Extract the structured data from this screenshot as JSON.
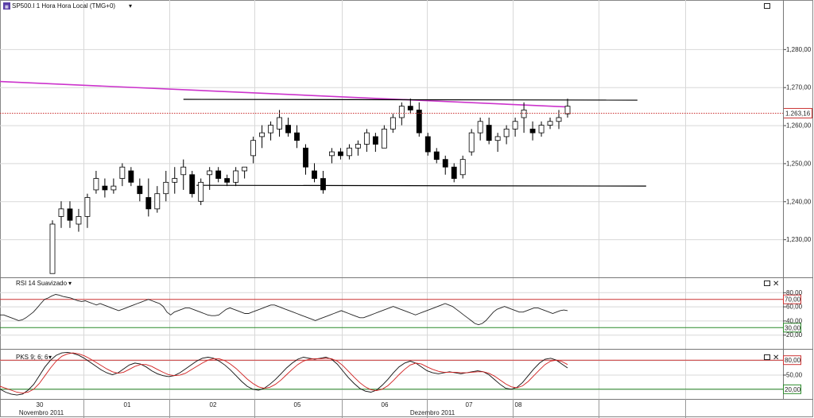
{
  "chart_data": [
    {
      "type": "candlestick",
      "title": "SP500.I 1 Hora Hora Local (TMG+0)",
      "ylim": [
        1220,
        1290
      ],
      "yticks": [
        "1,280,00",
        "1,270,00",
        "1,260,00",
        "1,250,00",
        "1,240,00",
        "1,230,00"
      ],
      "ytick_values": [
        1280,
        1270,
        1260,
        1250,
        1240,
        1230
      ],
      "price_label": "1.263,16",
      "price_line": 1263.16,
      "trendlines": [
        {
          "name": "resistance-trendline",
          "color": "#cc33cc",
          "from": [
            0,
            1271.5
          ],
          "to": [
            59,
            1264.8
          ]
        },
        {
          "name": "range-top-line",
          "color": "#000000",
          "from": [
            15,
            1266.8
          ],
          "to": [
            67,
            1266.6
          ]
        },
        {
          "name": "range-bottom-line",
          "color": "#000000",
          "from": [
            16.5,
            1244.2
          ],
          "to": [
            68,
            1244
          ]
        }
      ],
      "grid": true,
      "candles": [
        [
          1221,
          1235,
          1221,
          1234
        ],
        [
          1236,
          1240,
          1233,
          1238
        ],
        [
          1238,
          1240,
          1233,
          1235
        ],
        [
          1234,
          1238,
          1232,
          1236
        ],
        [
          1236,
          1242,
          1233,
          1241
        ],
        [
          1243,
          1248,
          1242,
          1246
        ],
        [
          1244,
          1246,
          1241,
          1243
        ],
        [
          1243,
          1246,
          1242,
          1244
        ],
        [
          1246,
          1250,
          1244,
          1249
        ],
        [
          1248,
          1249,
          1244,
          1245
        ],
        [
          1244,
          1246,
          1240,
          1242
        ],
        [
          1241,
          1246,
          1236,
          1238
        ],
        [
          1238,
          1244,
          1237,
          1242
        ],
        [
          1242,
          1248,
          1240,
          1245
        ],
        [
          1245,
          1249,
          1242,
          1246
        ],
        [
          1247,
          1251,
          1243,
          1249
        ],
        [
          1247,
          1248,
          1241,
          1242
        ],
        [
          1240,
          1246,
          1239,
          1245
        ],
        [
          1247,
          1249,
          1243,
          1248
        ],
        [
          1248,
          1249,
          1245,
          1246
        ],
        [
          1246,
          1247,
          1244,
          1245
        ],
        [
          1245,
          1249,
          1244,
          1248
        ],
        [
          1248,
          1249,
          1246,
          1249
        ],
        [
          1252,
          1257,
          1250,
          1256
        ],
        [
          1257,
          1260,
          1254,
          1258
        ],
        [
          1258,
          1261,
          1256,
          1260
        ],
        [
          1259,
          1264,
          1257,
          1262
        ],
        [
          1260,
          1262,
          1257,
          1258
        ],
        [
          1258,
          1260,
          1254,
          1256
        ],
        [
          1254,
          1255,
          1247,
          1249
        ],
        [
          1248,
          1250,
          1245,
          1246
        ],
        [
          1246,
          1248,
          1242,
          1243
        ],
        [
          1252,
          1254,
          1250,
          1253
        ],
        [
          1253,
          1254,
          1251,
          1252
        ],
        [
          1252,
          1255,
          1251,
          1254
        ],
        [
          1254,
          1256,
          1252,
          1255
        ],
        [
          1255,
          1259,
          1253,
          1258
        ],
        [
          1257,
          1258,
          1253,
          1255
        ],
        [
          1254,
          1260,
          1254,
          1259
        ],
        [
          1259,
          1263,
          1258,
          1262
        ],
        [
          1262,
          1266,
          1260,
          1265
        ],
        [
          1265,
          1267,
          1263,
          1264
        ],
        [
          1264,
          1266,
          1257,
          1258
        ],
        [
          1257,
          1258,
          1252,
          1253
        ],
        [
          1253,
          1254,
          1250,
          1251
        ],
        [
          1251,
          1252,
          1247,
          1249
        ],
        [
          1249,
          1250,
          1245,
          1246
        ],
        [
          1247,
          1252,
          1246,
          1251
        ],
        [
          1253,
          1259,
          1252,
          1258
        ],
        [
          1258,
          1262,
          1256,
          1261
        ],
        [
          1260,
          1262,
          1255,
          1256
        ],
        [
          1256,
          1258,
          1253,
          1257
        ],
        [
          1257,
          1260,
          1255,
          1259
        ],
        [
          1259,
          1262,
          1257,
          1261
        ],
        [
          1262,
          1266,
          1258,
          1264
        ],
        [
          1259,
          1261,
          1256,
          1258
        ],
        [
          1258,
          1261,
          1257,
          1260
        ],
        [
          1260,
          1262,
          1259,
          1261
        ],
        [
          1261,
          1264,
          1259,
          1262
        ],
        [
          1263,
          1267,
          1262,
          1265
        ]
      ]
    },
    {
      "type": "line",
      "title": "RSI 14 Suavizado",
      "ylim": [
        0,
        100
      ],
      "yticks": [
        "80,00",
        "60,00",
        "40,00",
        "20,00"
      ],
      "ytick_values": [
        80,
        60,
        40,
        20
      ],
      "levels": [
        {
          "value": 70,
          "label": "70,00",
          "color": "#cc3333"
        },
        {
          "value": 30,
          "label": "30,00",
          "color": "#2a8a2a"
        }
      ],
      "values": [
        48,
        48,
        46,
        44,
        42,
        40,
        41,
        44,
        48,
        52,
        58,
        64,
        70,
        72,
        75,
        77,
        76,
        74,
        73,
        72,
        70,
        68,
        67,
        68,
        66,
        64,
        62,
        64,
        62,
        60,
        58,
        56,
        54,
        56,
        58,
        60,
        62,
        64,
        66,
        68,
        70,
        68,
        66,
        64,
        60,
        52,
        48,
        52,
        54,
        56,
        58,
        58,
        56,
        54,
        52,
        50,
        48,
        47,
        47,
        48,
        52,
        56,
        58,
        56,
        54,
        52,
        50,
        50,
        52,
        54,
        56,
        58,
        60,
        62,
        62,
        60,
        58,
        56,
        54,
        52,
        50,
        48,
        46,
        44,
        42,
        40,
        42,
        44,
        46,
        48,
        50,
        52,
        54,
        52,
        50,
        48,
        46,
        44,
        44,
        46,
        48,
        50,
        52,
        54,
        56,
        58,
        60,
        58,
        56,
        54,
        52,
        50,
        48,
        50,
        52,
        54,
        56,
        58,
        60,
        62,
        64,
        62,
        60,
        56,
        52,
        48,
        44,
        40,
        36,
        34,
        36,
        40,
        46,
        52,
        56,
        58,
        60,
        58,
        56,
        54,
        52,
        52,
        54,
        56,
        58,
        58,
        56,
        54,
        52,
        50,
        52,
        54,
        55,
        54
      ]
    },
    {
      "type": "line",
      "title": "PKS 9; 6; 6",
      "ylim": [
        0,
        100
      ],
      "yticks": [
        "80,00",
        "50,00",
        "20,00"
      ],
      "ytick_values": [
        80,
        50,
        20
      ],
      "levels": [
        {
          "value": 80,
          "label": "80,00",
          "color": "#cc3333"
        },
        {
          "value": 20,
          "label": "20,00",
          "color": "#2a8a2a"
        }
      ],
      "series": [
        {
          "color": "#111111",
          "values": [
            20,
            14,
            10,
            8,
            10,
            18,
            30,
            48,
            66,
            80,
            90,
            95,
            96,
            94,
            90,
            84,
            76,
            68,
            60,
            54,
            50,
            54,
            62,
            70,
            74,
            72,
            66,
            58,
            52,
            48,
            46,
            48,
            54,
            62,
            70,
            78,
            84,
            86,
            84,
            78,
            70,
            60,
            48,
            36,
            26,
            20,
            18,
            22,
            30,
            40,
            52,
            64,
            74,
            82,
            86,
            84,
            82,
            84,
            86,
            82,
            72,
            58,
            44,
            32,
            22,
            16,
            14,
            18,
            28,
            40,
            54,
            66,
            74,
            78,
            74,
            66,
            58,
            54,
            52,
            54,
            56,
            54,
            52,
            54,
            56,
            58,
            56,
            50,
            40,
            30,
            22,
            20,
            24,
            34,
            48,
            62,
            74,
            82,
            84,
            80,
            72,
            64
          ]
        },
        {
          "color": "#d02020",
          "values": [
            26,
            22,
            18,
            14,
            12,
            14,
            20,
            32,
            48,
            64,
            78,
            88,
            93,
            95,
            93,
            89,
            83,
            76,
            69,
            62,
            56,
            53,
            55,
            61,
            67,
            71,
            71,
            67,
            61,
            55,
            50,
            48,
            49,
            53,
            60,
            67,
            74,
            80,
            83,
            83,
            79,
            72,
            63,
            52,
            41,
            32,
            25,
            22,
            24,
            30,
            39,
            50,
            61,
            71,
            78,
            82,
            83,
            83,
            84,
            83,
            78,
            69,
            57,
            45,
            34,
            25,
            19,
            17,
            20,
            27,
            38,
            50,
            61,
            70,
            74,
            72,
            66,
            61,
            57,
            55,
            55,
            55,
            54,
            54,
            55,
            56,
            56,
            53,
            47,
            39,
            31,
            25,
            23,
            27,
            36,
            48,
            60,
            71,
            78,
            80,
            77,
            71
          ]
        }
      ]
    }
  ],
  "time_axis": {
    "day_labels": [
      "30",
      "01",
      "02",
      "05",
      "06",
      "07",
      "08"
    ],
    "month_labels": [
      "Novembro 2011",
      "Dezembro 2011"
    ]
  },
  "colors": {
    "bull_candle": "#ffffff",
    "bear_candle": "#000000",
    "grid": "#d8d8d8",
    "price_line": "#cc3333",
    "price_tag_border": "#cc3333",
    "resistance_line": "#cc33cc"
  }
}
